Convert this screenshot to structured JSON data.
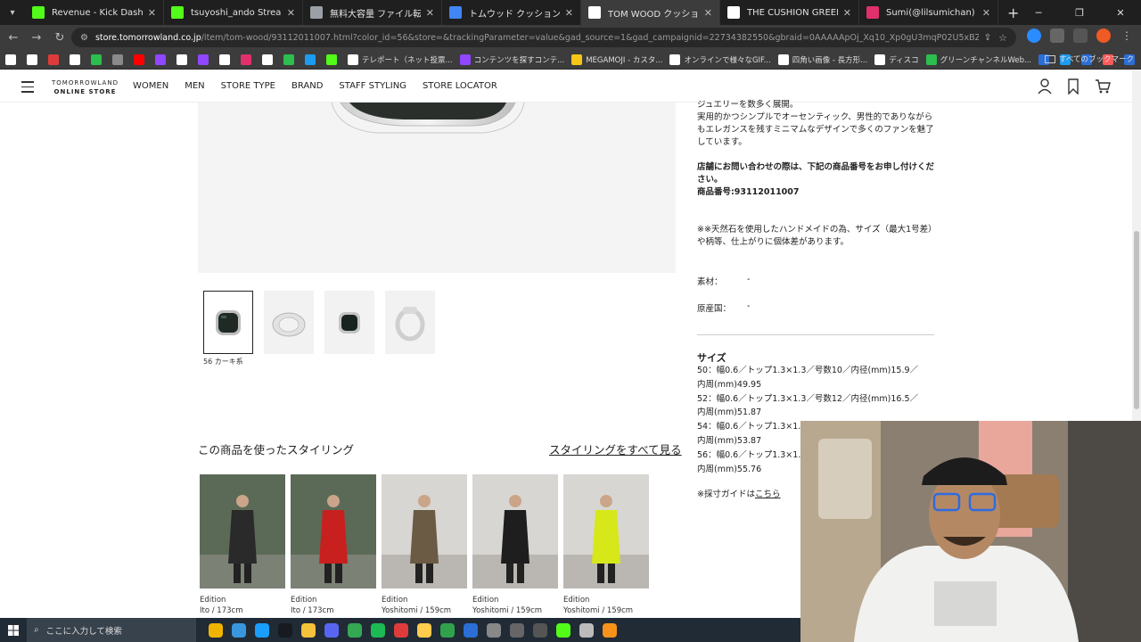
{
  "browser": {
    "tabs": [
      {
        "title": "Revenue - Kick Dashboard",
        "icon": "kick-icon",
        "color": "#53fc18"
      },
      {
        "title": "tsuyoshi_ando Stream - Watch",
        "icon": "kick-icon",
        "color": "#53fc18"
      },
      {
        "title": "無料大容量 ファイル転送サービス",
        "icon": "globe-icon",
        "color": "#9aa0a6"
      },
      {
        "title": "トムウッド クッションリング マーブル",
        "icon": "google-icon",
        "color": "#4285f4"
      },
      {
        "title": "TOM WOOD クッション グリーンマ",
        "icon": "tomorrowland-icon",
        "color": "#ffffff",
        "active": true
      },
      {
        "title": "THE CUSHION GREEN MARBLE",
        "icon": "site-icon",
        "color": "#ffffff"
      },
      {
        "title": "Sumi(@lilsumichan) • Instagram",
        "icon": "instagram-icon",
        "color": "#e1306c"
      }
    ],
    "url_domain": "store.tomorrowland.co.jp",
    "url_path": "/item/tom-wood/93112011007.html?color_id=56&store=&trackingParameter=value&gad_source=1&gad_campaignid=22734382550&gbraid=0AAAAApOj_Xq10_Xp0gU3mqP02U5xBZjr1&gclid=Cj0KCQjw5onGB...",
    "bookmarks": [
      {
        "label": "",
        "color": "#ffffff"
      },
      {
        "label": "",
        "color": "#ffffff"
      },
      {
        "label": "",
        "color": "#e03b3b"
      },
      {
        "label": "",
        "color": "#ffffff"
      },
      {
        "label": "",
        "color": "#2cbe4e"
      },
      {
        "label": "",
        "color": "#8a8a8a"
      },
      {
        "label": "",
        "color": "#ff0000"
      },
      {
        "label": "",
        "color": "#9146ff"
      },
      {
        "label": "",
        "color": "#ffffff"
      },
      {
        "label": "",
        "color": "#9146ff"
      },
      {
        "label": "",
        "color": "#ffffff"
      },
      {
        "label": "",
        "color": "#e1306c"
      },
      {
        "label": "",
        "color": "#ffffff"
      },
      {
        "label": "",
        "color": "#2cbe4e"
      },
      {
        "label": "",
        "color": "#1d9bf0"
      },
      {
        "label": "",
        "color": "#53fc18"
      },
      {
        "label": "テレポート（ネット投票...",
        "color": "#ffffff"
      },
      {
        "label": "コンテンツを探すコンテ...",
        "color": "#9146ff"
      },
      {
        "label": "MEGAMOJI - カスタ...",
        "color": "#f5c518"
      },
      {
        "label": "オンラインで様々なGIF...",
        "color": "#ffffff"
      },
      {
        "label": "四角い画像 - 長方形...",
        "color": "#ffffff"
      },
      {
        "label": "ディスコ",
        "color": "#ffffff"
      },
      {
        "label": "グリーンチャンネルWeb...",
        "color": "#2cbe4e"
      },
      {
        "label": "",
        "color": "#2b6ed6"
      },
      {
        "label": "",
        "color": "#1d9bf0"
      },
      {
        "label": "",
        "color": "#2b6ed6"
      },
      {
        "label": "",
        "color": "#ff5a5a"
      },
      {
        "label": "",
        "color": "#2b6ed6"
      }
    ],
    "all_bookmarks": "すべてのブックマーク"
  },
  "site": {
    "logo_line1": "TOMORROWLAND",
    "logo_line2": "ONLINE STORE",
    "nav": [
      "WOMEN",
      "MEN",
      "STORE TYPE",
      "BRAND",
      "STAFF STYLING",
      "STORE LOCATOR"
    ]
  },
  "product": {
    "thumb_caption": "56 カーキ系",
    "desc1": "ジュエリーを数多く展開。\n実用的かつシンプルでオーセンティック、男性的でありながらもエレガンスを残すミニマムなデザインで多くのファンを魅了しています。",
    "desc2": "店舗にお問い合わせの際は、下記の商品番号をお申し付けください。\n商品番号:93112011007",
    "desc3": "※※天然石を使用したハンドメイドの為、サイズ（最大1号差）や柄等、仕上がりに個体差があります。",
    "material_label": "素材：",
    "material_value": "-",
    "origin_label": "原産国：",
    "origin_value": "-",
    "size_heading": "サイズ",
    "sizes": [
      "50：幅0.6／トップ1.3×1.3／号数10／内径(mm)15.9／",
      "内周(mm)49.95",
      "52：幅0.6／トップ1.3×1.3／号数12／内径(mm)16.5／",
      "内周(mm)51.87",
      "54：幅0.6／トップ1.3×1.3",
      "内周(mm)53.87",
      "56：幅0.6／トップ1.3×1.3",
      "内周(mm)55.76"
    ],
    "guide_prefix": "※採寸ガイドは",
    "guide_link": "こちら"
  },
  "styling": {
    "heading": "この商品を使ったスタイリング",
    "see_all": "スタイリングをすべて見る",
    "cards": [
      {
        "store": "Edition",
        "staff": "Ito / 173cm",
        "bg": "#5b6a57",
        "coat": "#2a2a2a"
      },
      {
        "store": "Edition",
        "staff": "Ito / 173cm",
        "bg": "#5b6a57",
        "coat": "#c8201e"
      },
      {
        "store": "Edition",
        "staff": "Yoshitomi / 159cm",
        "bg": "#d8d6d2",
        "coat": "#6b5a44"
      },
      {
        "store": "Edition",
        "staff": "Yoshitomi / 159cm",
        "bg": "#d8d6d2",
        "coat": "#1e1e1e"
      },
      {
        "store": "Edition",
        "staff": "Yoshitomi / 159cm",
        "bg": "#d8d6d2",
        "coat": "#d6e81a"
      }
    ]
  },
  "taskbar": {
    "search_placeholder": "ここに入力して検索",
    "apps": [
      "#f0b400",
      "#3a96dd",
      "#1a9fff",
      "#171a21",
      "#f3c13a",
      "#5865f2",
      "#34a853",
      "#1db954",
      "#e03b3b",
      "#ffcc4d",
      "#31a24c",
      "#2b6ed6",
      "#888888",
      "#666666",
      "#555555",
      "#53fc18",
      "#bbbbbb",
      "#f7931a"
    ]
  }
}
